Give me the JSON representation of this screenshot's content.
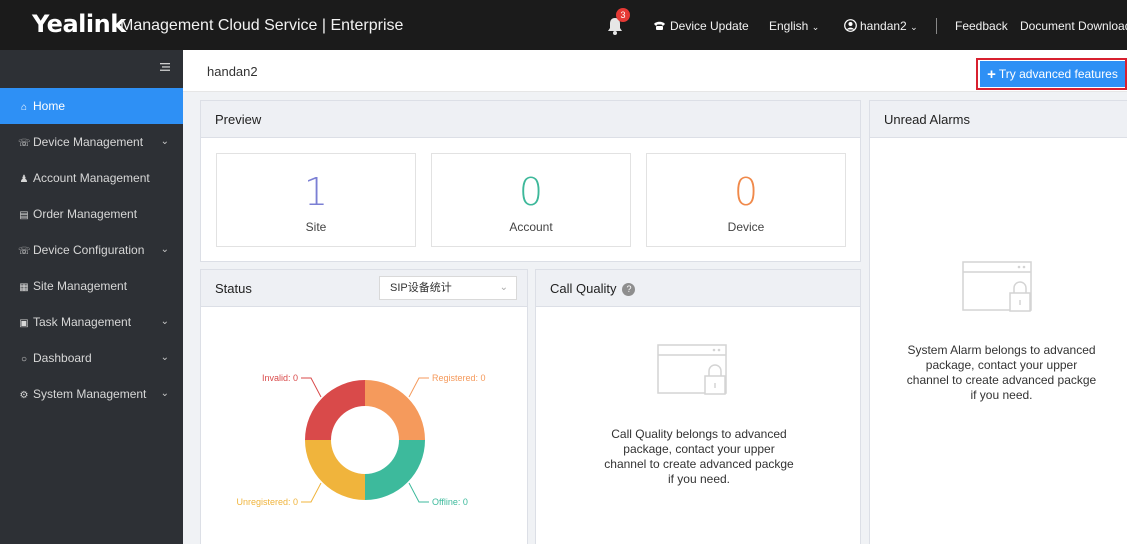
{
  "app": {
    "logo": "Yealink",
    "title": "Management Cloud Service | Enterprise"
  },
  "topnav": {
    "notification_count": "3",
    "device_update": "Device Update",
    "language": "English",
    "username": "handan2",
    "feedback": "Feedback",
    "document_download": "Document Download"
  },
  "sidebar": {
    "items": [
      {
        "label": "Home",
        "icon": "home-icon",
        "active": true
      },
      {
        "label": "Device Management",
        "icon": "phone-icon",
        "expandable": true
      },
      {
        "label": "Account Management",
        "icon": "user-icon"
      },
      {
        "label": "Order Management",
        "icon": "document-icon"
      },
      {
        "label": "Device Configuration",
        "icon": "phone-icon",
        "expandable": true
      },
      {
        "label": "Site Management",
        "icon": "building-icon"
      },
      {
        "label": "Task Management",
        "icon": "task-icon",
        "expandable": true
      },
      {
        "label": "Dashboard",
        "icon": "dashboard-icon",
        "expandable": true
      },
      {
        "label": "System Management",
        "icon": "gear-icon",
        "expandable": true
      }
    ]
  },
  "header": {
    "user": "handan2",
    "try_button": "Try advanced features"
  },
  "preview": {
    "title": "Preview",
    "cards": [
      {
        "value": "1",
        "label": "Site",
        "color": "#7b7fd4"
      },
      {
        "value": "0",
        "label": "Account",
        "color": "#3db89a"
      },
      {
        "value": "0",
        "label": "Device",
        "color": "#f0894a"
      }
    ]
  },
  "status": {
    "title": "Status",
    "select_value": "SIP设备统计",
    "labels": {
      "invalid": "Invalid: 0",
      "registered": "Registered: 0",
      "unregistered": "Unregistered: 0",
      "offline": "Offline: 0"
    },
    "colors": {
      "invalid": "#d94a4a",
      "registered": "#f59a5c",
      "unregistered": "#f0b43c",
      "offline": "#3dba9c"
    }
  },
  "call_quality": {
    "title": "Call Quality",
    "message_lines": [
      "Call Quality belongs to advanced",
      "package, contact your upper",
      "channel to create advanced packge",
      "if you need."
    ]
  },
  "alarms": {
    "title": "Unread Alarms",
    "message_lines": [
      "System Alarm belongs to advanced",
      "package, contact your upper",
      "channel to create advanced packge",
      "if you need."
    ]
  },
  "colors": {
    "accent": "#2e90f5",
    "sidebar_bg": "#2d3035",
    "topbar_bg": "#1b1b1b",
    "highlight_border": "#d8202f"
  }
}
